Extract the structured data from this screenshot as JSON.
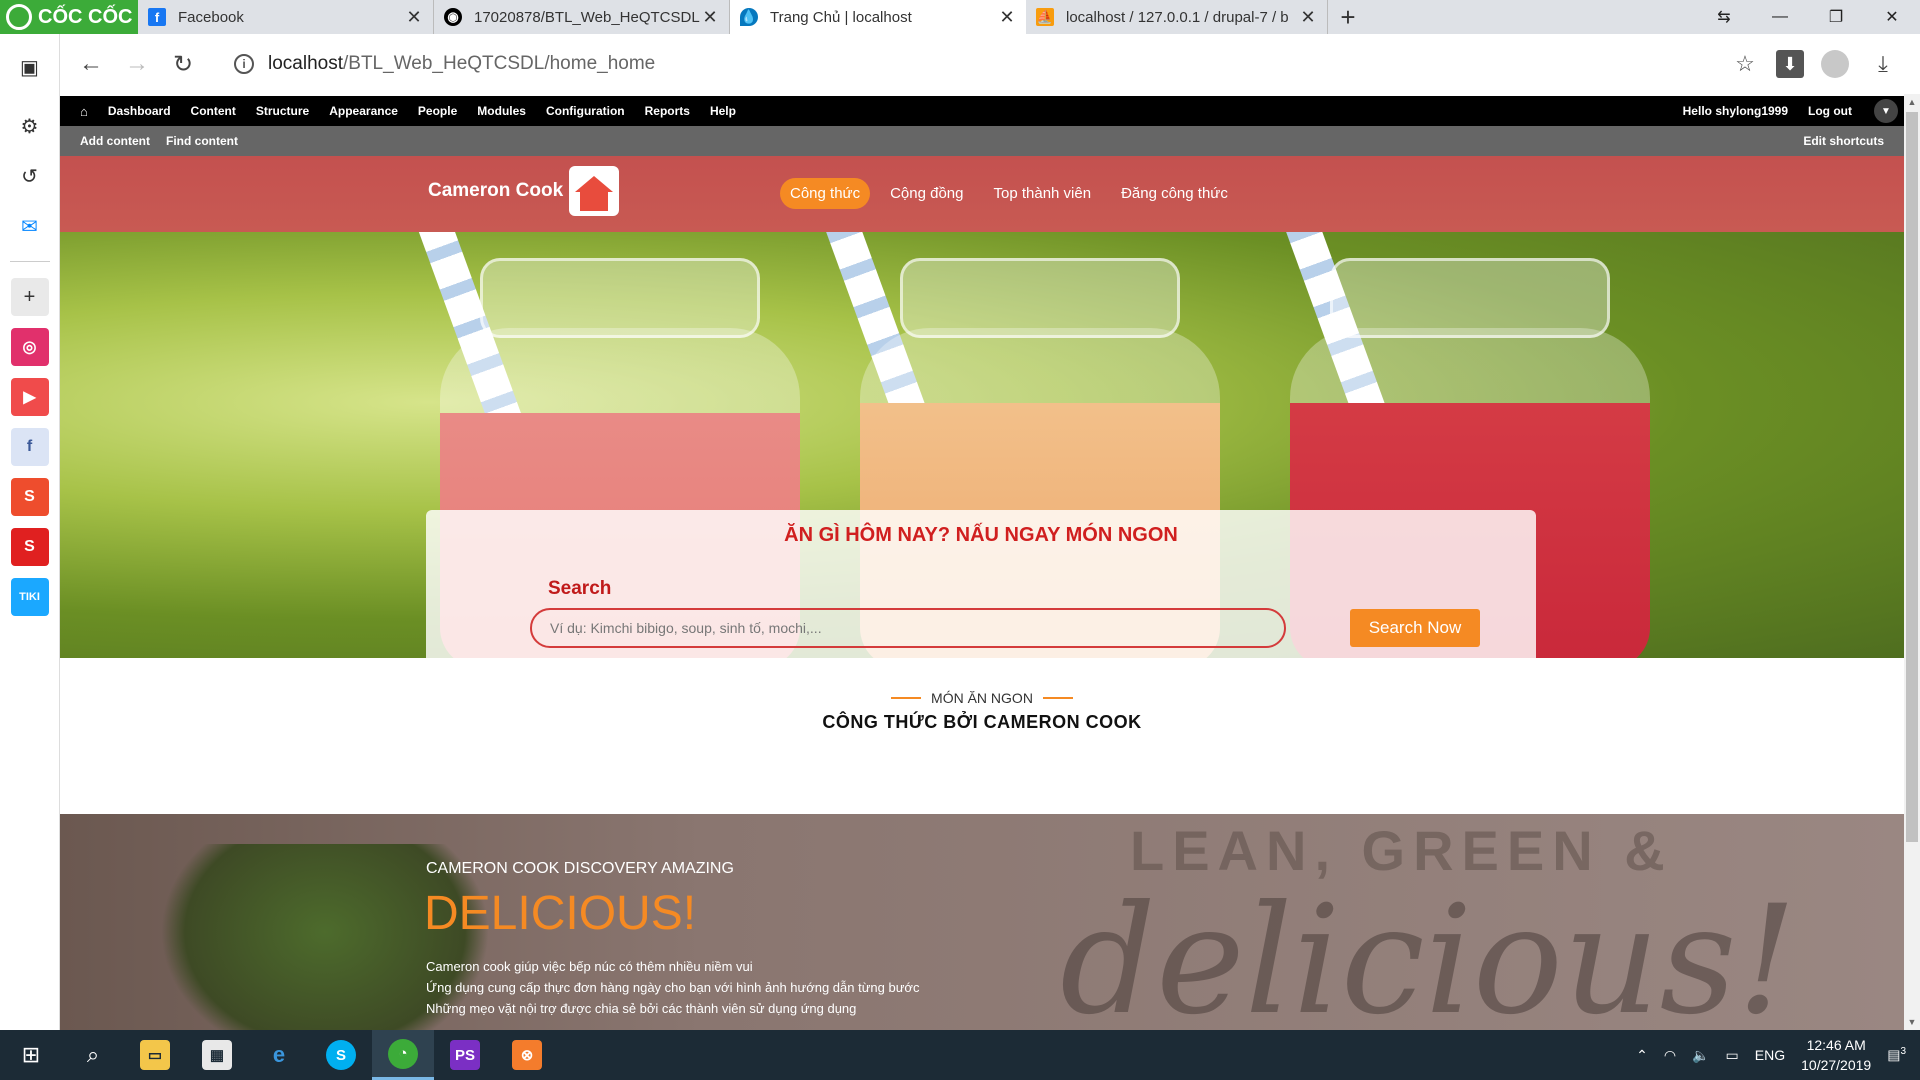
{
  "browser": {
    "brand": "CỐC CỐC",
    "tabs": [
      {
        "title": "Facebook",
        "favicon": "facebook-icon",
        "color": "#1877f2",
        "active": false
      },
      {
        "title": "17020878/BTL_Web_HeQTCSDL",
        "favicon": "github-icon",
        "color": "#000000",
        "active": false
      },
      {
        "title": "Trang Chủ | localhost",
        "favicon": "drupal-icon",
        "color": "#0678be",
        "active": true
      },
      {
        "title": "localhost / 127.0.0.1 / drupal-7 / b",
        "favicon": "phpmyadmin-icon",
        "color": "#f89c0e",
        "active": false
      }
    ],
    "url_host": "localhost",
    "url_path": "/BTL_Web_HeQTCSDL/home_home"
  },
  "drupal_toolbar": {
    "items": [
      "Dashboard",
      "Content",
      "Structure",
      "Appearance",
      "People",
      "Modules",
      "Configuration",
      "Reports",
      "Help"
    ],
    "hello_prefix": "Hello ",
    "username": "shylong1999",
    "logout": "Log out",
    "shortcuts": [
      "Add content",
      "Find content"
    ],
    "edit_shortcuts": "Edit shortcuts"
  },
  "site": {
    "brand": "Cameron Cook",
    "nav": [
      {
        "label": "Công thức",
        "active": true
      },
      {
        "label": "Cộng đồng",
        "active": false
      },
      {
        "label": "Top thành viên",
        "active": false
      },
      {
        "label": "Đăng công thức",
        "active": false
      }
    ],
    "accent": "#f58a23"
  },
  "hero": {
    "headline": "ĂN GÌ HÔM NAY? NẤU NGAY MÓN NGON",
    "search_label": "Search",
    "search_placeholder": "Ví dụ: Kimchi bibigo, soup, sinh tố, mochi,...",
    "search_button": "Search Now"
  },
  "section": {
    "eyebrow": "MÓN ĂN NGON",
    "title": "CÔNG THỨC BỞI CAMERON COOK"
  },
  "discovery": {
    "eyebrow": "CAMERON COOK DISCOVERY AMAZING",
    "big": "DELICIOUS!",
    "lines": [
      "Cameron cook giúp việc bếp núc có thêm nhiều niềm vui",
      "Ứng dụng cung cấp thực đơn hàng ngày cho bạn với hình ảnh hướng dẫn từng bước",
      "Những mẹo vặt nội trợ được chia sẻ bởi các thành viên sử dụng ứng dụng"
    ],
    "bg_text": "LEAN, GREEN &",
    "bg_script": "delicious!"
  },
  "taskbar": {
    "language": "ENG",
    "time": "12:46 AM",
    "date": "10/27/2019",
    "notifications": "3"
  }
}
